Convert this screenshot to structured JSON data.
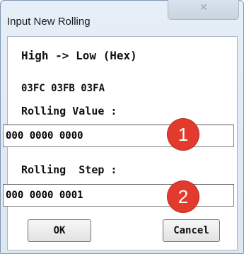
{
  "window": {
    "title": "Input New Rolling"
  },
  "dialog": {
    "heading": "High -> Low (Hex)",
    "hex_values": "03FC 03FB 03FA",
    "rolling_value_label": "Rolling Value :",
    "rolling_value": "000 0000 0000",
    "rolling_step_label": "Rolling  Step :",
    "rolling_step": "000 0000 0001"
  },
  "annotations": {
    "marker_1": "1",
    "marker_2": "2",
    "marker_color": "#e23b2e"
  },
  "buttons": {
    "ok": "OK",
    "cancel": "Cancel"
  },
  "icons": {
    "close": "close-icon"
  }
}
